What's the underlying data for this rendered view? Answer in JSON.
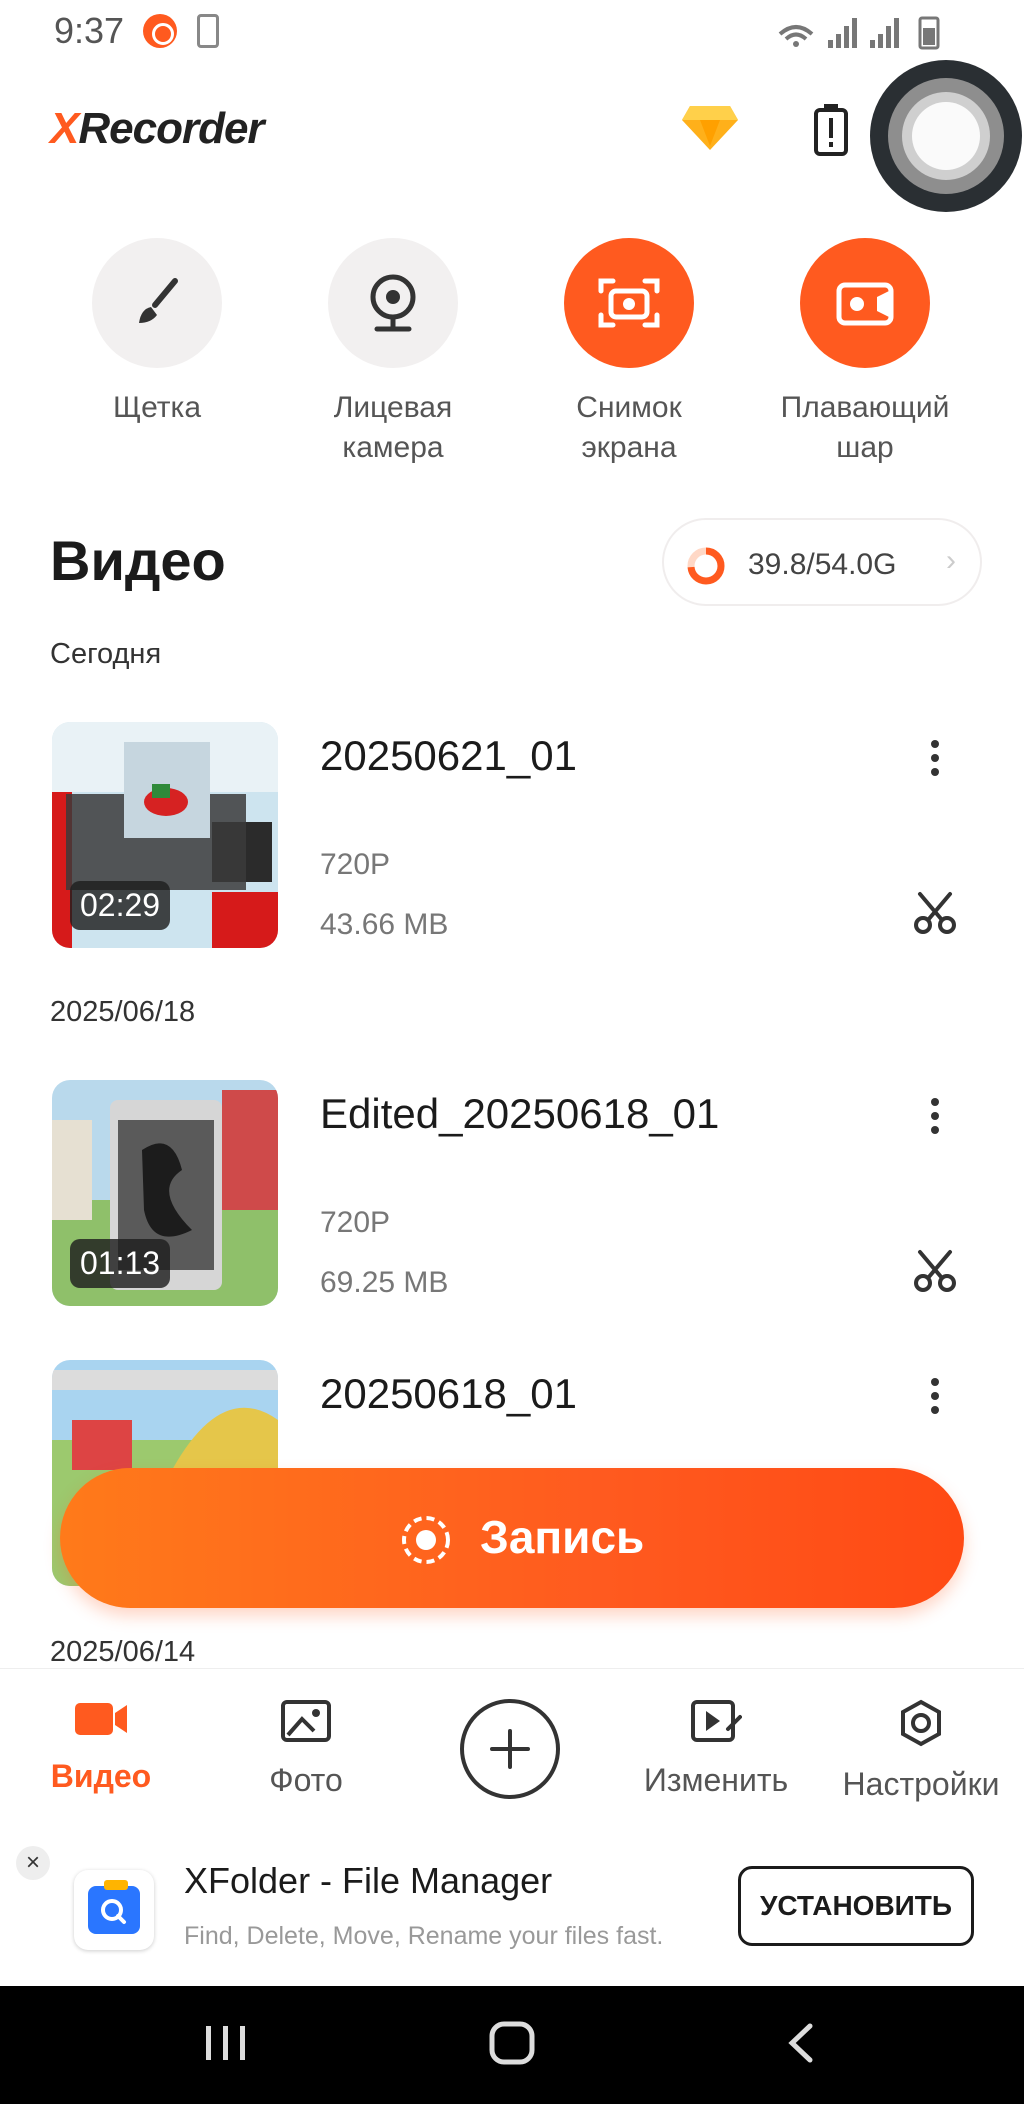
{
  "status_bar": {
    "time": "9:37"
  },
  "header": {
    "logo_prefix": "X",
    "logo_rest": "Recorder"
  },
  "tools": [
    {
      "label": "Щетка"
    },
    {
      "label": "Лицевая камера"
    },
    {
      "label": "Снимок экрана"
    },
    {
      "label": "Плавающий шар"
    }
  ],
  "section": {
    "title": "Видео",
    "storage": "39.8/54.0G",
    "storage_fraction": 0.737
  },
  "groups": [
    {
      "date": "Сегодня"
    },
    {
      "date": "2025/06/18"
    },
    {
      "date": "2025/06/14"
    }
  ],
  "videos": [
    {
      "name": "20250621_01",
      "resolution": "720P",
      "size": "43.66 MB",
      "duration": "02:29"
    },
    {
      "name": "Edited_20250618_01",
      "resolution": "720P",
      "size": "69.25 MB",
      "duration": "01:13"
    },
    {
      "name": "20250618_01"
    }
  ],
  "record_button": {
    "label": "Запись"
  },
  "bottom_nav": [
    {
      "label": "Видео"
    },
    {
      "label": "Фото"
    },
    {
      "label": "Изменить"
    },
    {
      "label": "Настройки"
    }
  ],
  "ad": {
    "title": "XFolder - File Manager",
    "description": "Find, Delete, Move, Rename your files fast.",
    "install_label": "УСТАНОВИТЬ"
  },
  "colors": {
    "accent": "#ff5a1f"
  }
}
